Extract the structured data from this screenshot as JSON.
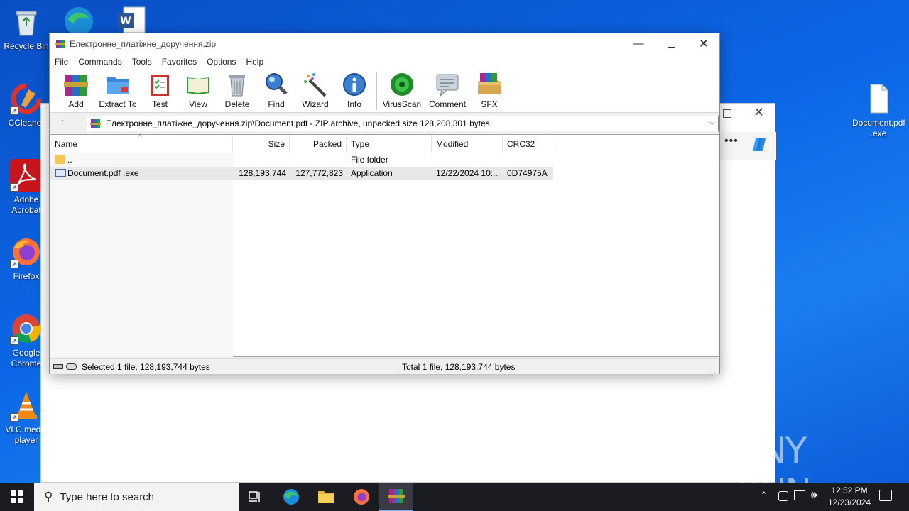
{
  "desktop": {
    "icons": [
      {
        "label": "Recycle Bin",
        "icon": "recycle-bin-icon"
      },
      {
        "label": "CCleaner",
        "icon": "ccleaner-icon"
      },
      {
        "label": "Adobe Acrobat",
        "icon": "adobe-acrobat-icon"
      },
      {
        "label": "Firefox",
        "icon": "firefox-icon"
      },
      {
        "label": "Google Chrome",
        "icon": "chrome-icon"
      },
      {
        "label": "VLC media player",
        "icon": "vlc-icon"
      },
      {
        "label": "Document.pdf .exe",
        "icon": "file-icon"
      }
    ],
    "watermark": "ANY RUN"
  },
  "window": {
    "title": "Електронне_платіжне_доручення.zip",
    "menu": [
      "File",
      "Commands",
      "Tools",
      "Favorites",
      "Options",
      "Help"
    ],
    "toolbar": [
      "Add",
      "Extract To",
      "Test",
      "View",
      "Delete",
      "Find",
      "Wizard",
      "Info",
      "VirusScan",
      "Comment",
      "SFX"
    ],
    "address": "Електронне_платіжне_доручення.zip\\Document.pdf  - ZIP archive, unpacked size 128,208,301 bytes",
    "columns": [
      "Name",
      "Size",
      "Packed",
      "Type",
      "Modified",
      "CRC32"
    ],
    "rows": [
      {
        "name": "..",
        "size": "",
        "packed": "",
        "type": "File folder",
        "modified": "",
        "crc": ""
      },
      {
        "name": "Document.pdf .exe",
        "size": "128,193,744",
        "packed": "127,772,823",
        "type": "Application",
        "modified": "12/22/2024 10:...",
        "crc": "0D74975A"
      }
    ],
    "status_left": "Selected 1 file, 128,193,744 bytes",
    "status_right": "Total 1 file, 128,193,744 bytes"
  },
  "taskbar": {
    "search_placeholder": "Type here to search",
    "time": "12:52 PM",
    "date": "12/23/2024"
  },
  "colors": {
    "desktop": "#0b67e6",
    "taskbar": "#1b1b22",
    "selected_row": "#e8e8e8"
  }
}
